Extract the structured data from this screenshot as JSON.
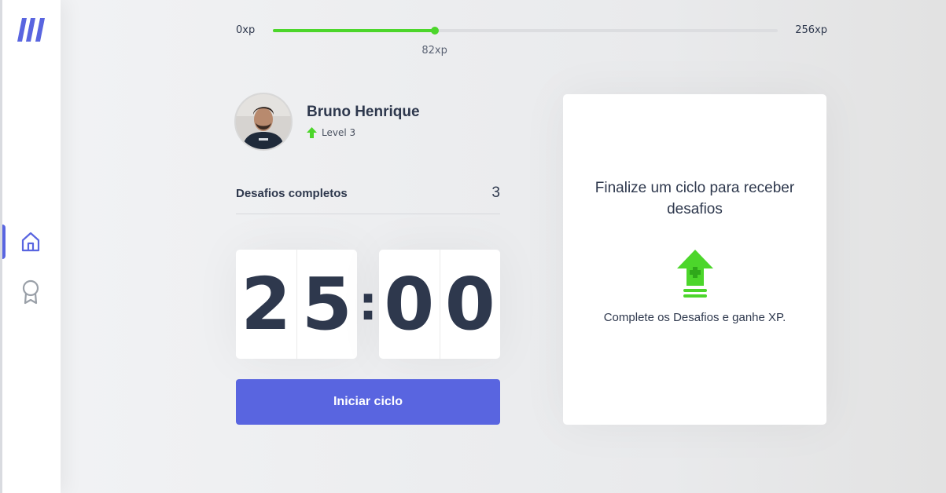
{
  "sidebar": {
    "logo_icon": "move-it-logo-icon",
    "items": [
      {
        "icon": "home-icon",
        "active": true
      },
      {
        "icon": "award-icon",
        "active": false
      }
    ]
  },
  "xp": {
    "min_label": "0xp",
    "max_label": "256xp",
    "current_label": "82xp",
    "current": 82,
    "max": 256
  },
  "profile": {
    "name": "Bruno Henrique",
    "level_label": "Level 3",
    "level_icon": "level-up-arrow-icon"
  },
  "completed": {
    "label": "Desafios completos",
    "count": "3"
  },
  "countdown": {
    "minute_left": "2",
    "minute_right": "5",
    "separator": ":",
    "second_left": "0",
    "second_right": "0"
  },
  "start_button": {
    "label": "Iniciar ciclo"
  },
  "challenge": {
    "title": "Finalize um ciclo para receber desafios",
    "icon": "level-up-icon",
    "text": "Complete os Desafios e ganhe XP."
  },
  "colors": {
    "accent": "#5965e0",
    "green": "#4cd62b",
    "text": "#2e384d"
  }
}
